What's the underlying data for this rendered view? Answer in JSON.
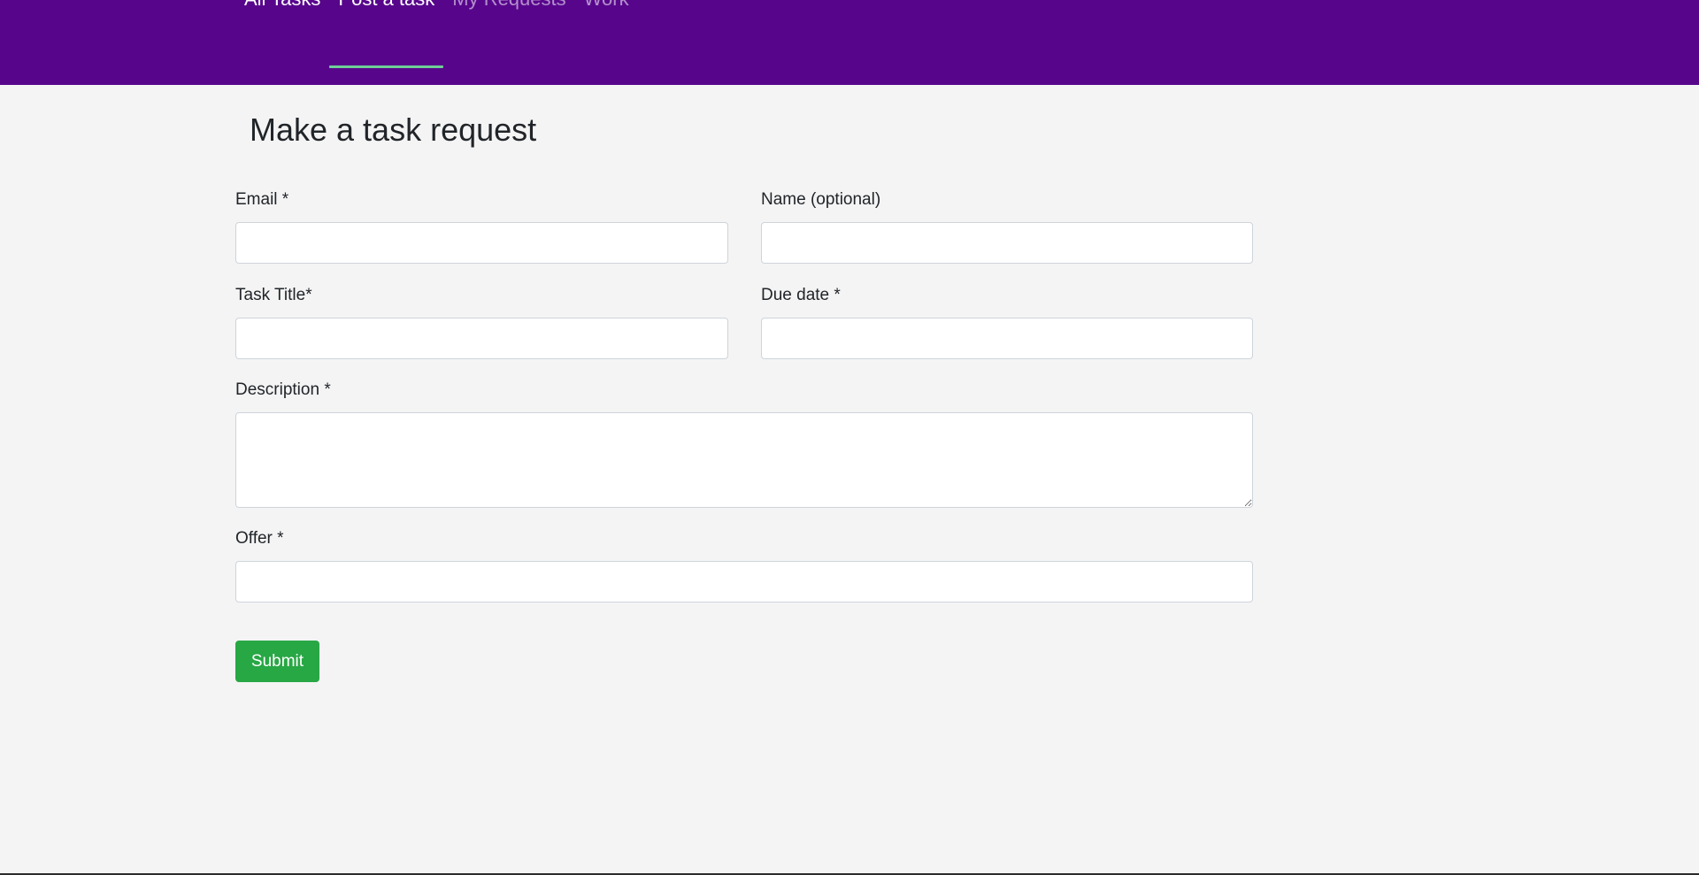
{
  "nav": {
    "items": [
      {
        "label": "All Tasks"
      },
      {
        "label": "Post a task"
      },
      {
        "label": "My Requests"
      },
      {
        "label": "Work"
      }
    ]
  },
  "page": {
    "title": "Make a task request"
  },
  "form": {
    "email_label": "Email *",
    "email_value": "",
    "name_label": "Name (optional)",
    "name_value": "",
    "task_title_label": "Task Title*",
    "task_title_value": "",
    "due_date_label": "Due date *",
    "due_date_value": "",
    "description_label": "Description *",
    "description_value": "",
    "offer_label": "Offer *",
    "offer_value": "",
    "submit_label": "Submit"
  },
  "colors": {
    "topbar": "#57068c",
    "active_underline": "#6fcf97",
    "submit": "#28a745",
    "background": "#f4f4f4"
  }
}
